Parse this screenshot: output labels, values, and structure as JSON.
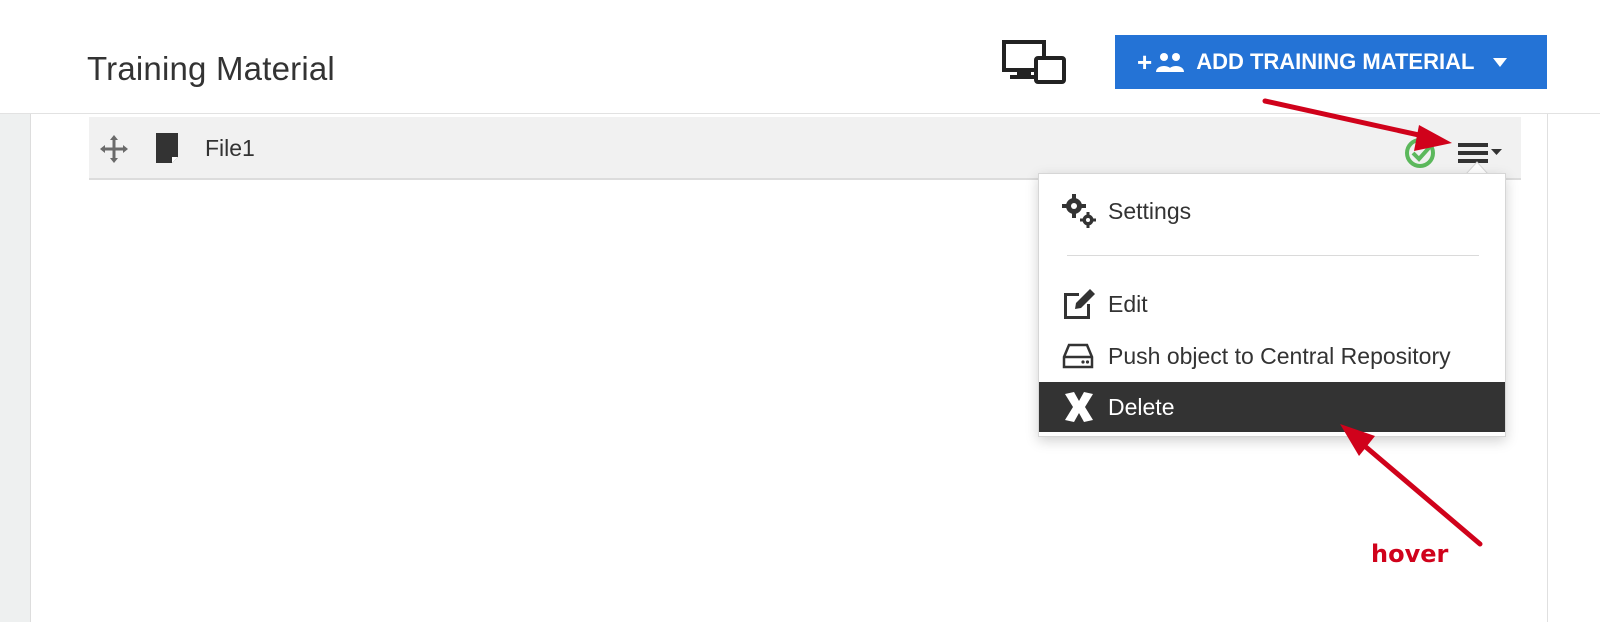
{
  "header": {
    "title": "Training Material",
    "add_button_label": "ADD TRAINING MATERIAL",
    "device_icon": "devices-icon",
    "accent_color": "#2473d6"
  },
  "file_row": {
    "name": "File1",
    "status_icon": "check-circle-icon",
    "status_color": "#5cb85c"
  },
  "menu": {
    "items": [
      {
        "label": "Settings",
        "icon": "gears-icon"
      },
      {
        "label": "Edit",
        "icon": "edit-icon"
      },
      {
        "label": "Push object to Central Repository",
        "icon": "drive-icon"
      },
      {
        "label": "Delete",
        "icon": "delete-x-icon",
        "state": "hover"
      }
    ]
  },
  "annotation": {
    "note": "hover",
    "color": "#d0021b"
  }
}
